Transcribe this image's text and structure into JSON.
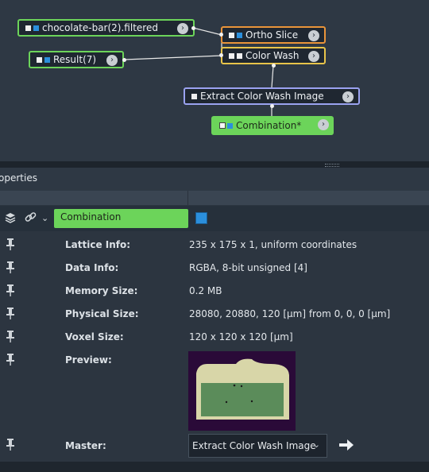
{
  "graph": {
    "nodes": {
      "chocolate": {
        "label": "chocolate-bar(2).filtered",
        "border": "#6cd45a"
      },
      "result": {
        "label": "Result(7)",
        "border": "#6cd45a"
      },
      "ortho": {
        "label": "Ortho Slice",
        "border": "#e9943a"
      },
      "colorwash": {
        "label": "Color Wash",
        "border": "#e8c44a"
      },
      "extract": {
        "label": "Extract Color Wash Image",
        "border": "#9aa2f0"
      },
      "combination": {
        "label": "Combination*",
        "bg": "#6cd45a"
      }
    }
  },
  "properties": {
    "title": "operties",
    "object_name": "Combination",
    "object_color": "#2b8fdc",
    "icons": [
      "layers-icon",
      "link-icon",
      "chevron-down-icon"
    ],
    "rows": [
      {
        "label": "Lattice Info:",
        "value": "235 x 175 x 1, uniform coordinates"
      },
      {
        "label": "Data Info:",
        "value": "RGBA, 8-bit unsigned [4]"
      },
      {
        "label": "Memory Size:",
        "value": "0.2 MB"
      },
      {
        "label": "Physical Size:",
        "value": "28080, 20880, 120 [µm] from 0, 0, 0 [µm]"
      },
      {
        "label": "Voxel Size:",
        "value": "120 x 120 x 120 [µm]"
      },
      {
        "label": "Preview:",
        "value": ""
      }
    ],
    "master": {
      "label": "Master:",
      "value": "Extract Color Wash Image"
    }
  }
}
